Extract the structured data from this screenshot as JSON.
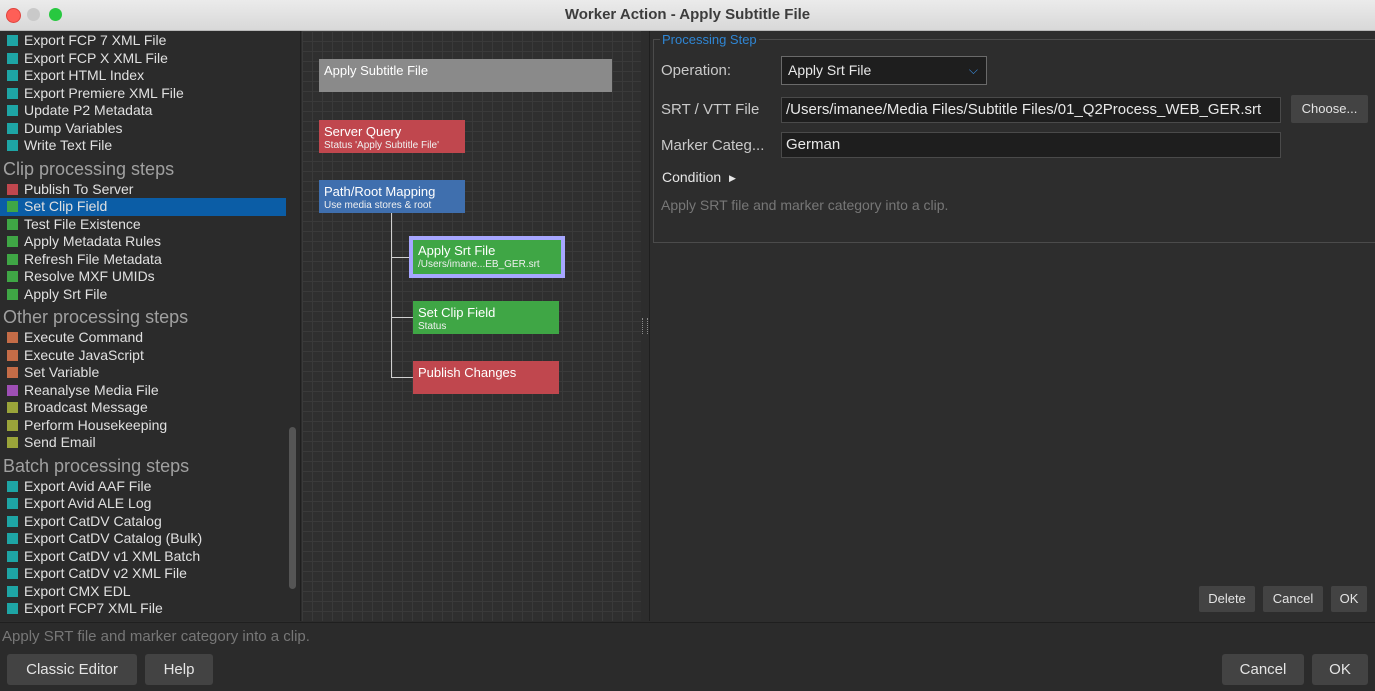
{
  "window": {
    "title": "Worker Action - Apply Subtitle File"
  },
  "step_list": {
    "top_items": [
      {
        "label": "Export FCP 7 XML File",
        "color": "#1ea5a5"
      },
      {
        "label": "Export FCP X XML File",
        "color": "#1ea5a5"
      },
      {
        "label": "Export HTML Index",
        "color": "#1ea5a5"
      },
      {
        "label": "Export Premiere XML File",
        "color": "#1ea5a5"
      },
      {
        "label": "Update P2 Metadata",
        "color": "#1ea5a5"
      },
      {
        "label": "Dump Variables",
        "color": "#1ea5a5"
      },
      {
        "label": "Write Text File",
        "color": "#1ea5a5"
      }
    ],
    "groups": [
      {
        "header": "Clip processing steps",
        "items": [
          {
            "label": "Publish To Server",
            "color": "#c0474e"
          },
          {
            "label": "Set Clip Field",
            "color": "#3fa645",
            "selected": true
          },
          {
            "label": "Test File Existence",
            "color": "#3fa645"
          },
          {
            "label": "Apply Metadata Rules",
            "color": "#3fa645"
          },
          {
            "label": "Refresh File Metadata",
            "color": "#3fa645"
          },
          {
            "label": "Resolve MXF UMIDs",
            "color": "#3fa645"
          },
          {
            "label": "Apply Srt File",
            "color": "#3fa645"
          }
        ]
      },
      {
        "header": "Other processing steps",
        "items": [
          {
            "label": "Execute Command",
            "color": "#c46c47"
          },
          {
            "label": "Execute JavaScript",
            "color": "#c46c47"
          },
          {
            "label": "Set Variable",
            "color": "#c46c47"
          },
          {
            "label": "Reanalyse Media File",
            "color": "#9e4fb5"
          },
          {
            "label": "Broadcast Message",
            "color": "#9aa43a"
          },
          {
            "label": "Perform Housekeeping",
            "color": "#9aa43a"
          },
          {
            "label": "Send Email",
            "color": "#9aa43a"
          }
        ]
      },
      {
        "header": "Batch processing steps",
        "items": [
          {
            "label": "Export Avid AAF File",
            "color": "#1ea5a5"
          },
          {
            "label": "Export Avid ALE Log",
            "color": "#1ea5a5"
          },
          {
            "label": "Export CatDV Catalog",
            "color": "#1ea5a5"
          },
          {
            "label": "Export CatDV Catalog (Bulk)",
            "color": "#1ea5a5"
          },
          {
            "label": "Export CatDV v1 XML Batch",
            "color": "#1ea5a5"
          },
          {
            "label": "Export CatDV v2 XML File",
            "color": "#1ea5a5"
          },
          {
            "label": "Export CMX EDL",
            "color": "#1ea5a5"
          },
          {
            "label": "Export FCP7 XML File",
            "color": "#1ea5a5"
          }
        ]
      }
    ]
  },
  "canvas": {
    "root": {
      "title": "Apply Subtitle File",
      "color": "#8a8a8a"
    },
    "nodes": [
      {
        "id": "server-query",
        "title": "Server Query",
        "subtitle": "Status 'Apply Subtitle File'",
        "color": "#c0474e"
      },
      {
        "id": "path-root-mapping",
        "title": "Path/Root Mapping",
        "subtitle": "Use media stores & root",
        "color": "#3f6fae"
      },
      {
        "id": "apply-srt-file",
        "title": "Apply Srt File",
        "subtitle": "/Users/imane...EB_GER.srt",
        "color": "#3fa645",
        "selected_border": "#a6a6ff"
      },
      {
        "id": "set-clip-field",
        "title": "Set Clip Field",
        "subtitle": "Status",
        "color": "#3fa645"
      },
      {
        "id": "publish-changes",
        "title": "Publish Changes",
        "subtitle": "",
        "color": "#c0474e"
      }
    ]
  },
  "processing_step": {
    "legend": "Processing Step",
    "operation_label": "Operation:",
    "operation_value": "Apply Srt File",
    "srt_label": "SRT / VTT File",
    "srt_value": "/Users/imanee/Media Files/Subtitle Files/01_Q2Process_WEB_GER.srt",
    "choose_label": "Choose...",
    "marker_label": "Marker Categ...",
    "marker_value": "German",
    "condition_label": "Condition",
    "description": "Apply SRT file and marker category into a clip.",
    "delete_label": "Delete",
    "cancel_label": "Cancel",
    "ok_label": "OK"
  },
  "footer": {
    "status_text": "Apply SRT file and marker category into a clip.",
    "classic_editor_label": "Classic Editor",
    "help_label": "Help",
    "cancel_label": "Cancel",
    "ok_label": "OK"
  }
}
